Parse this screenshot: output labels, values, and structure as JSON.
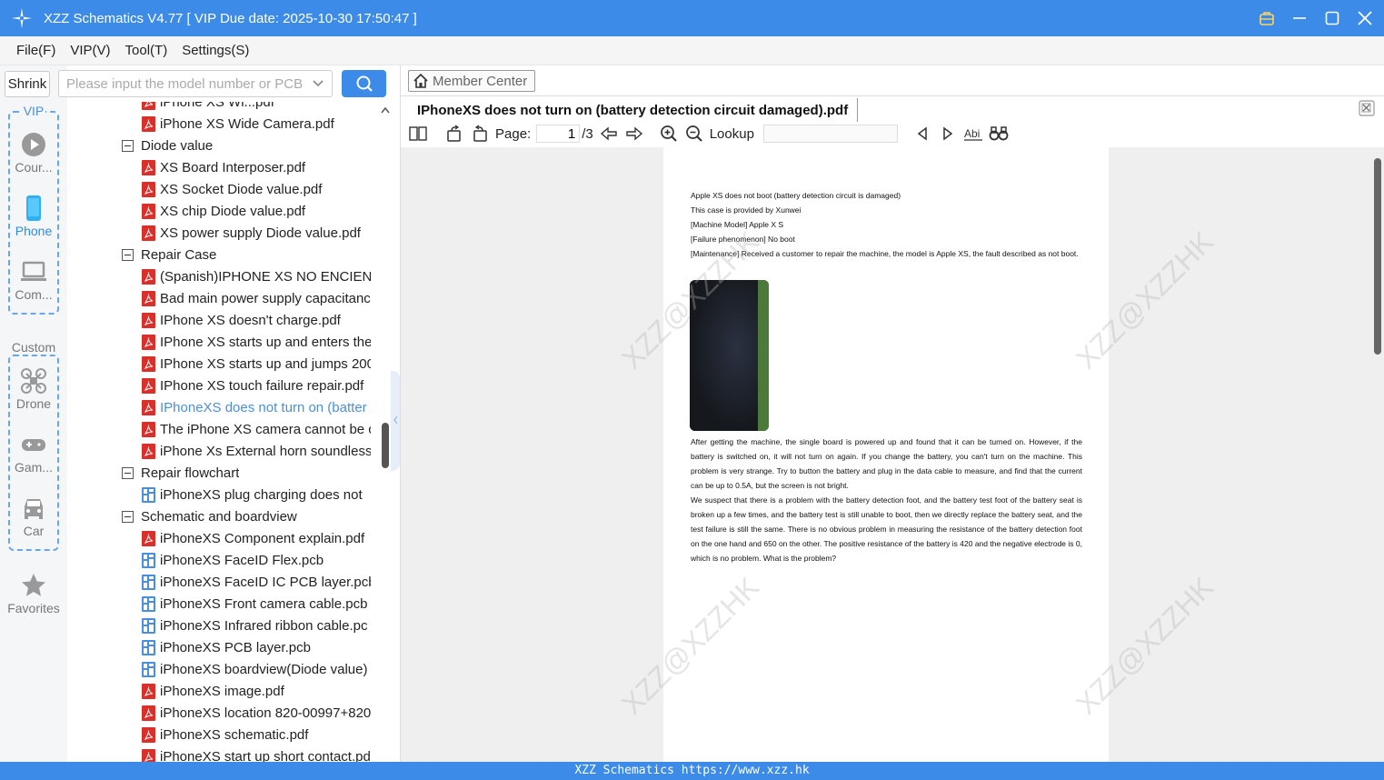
{
  "window": {
    "title": "XZZ Schematics V4.77 [ VIP Due date: 2025-10-30 17:50:47 ]"
  },
  "menu": [
    "File(F)",
    "VIP(V)",
    "Tool(T)",
    "Settings(S)"
  ],
  "left": {
    "shrink_label": "Shrink",
    "vip_label": "VIP",
    "custom_label": "Custom",
    "categories": [
      {
        "label": "Cour...",
        "icon": "play-circle-icon"
      },
      {
        "label": "Phone",
        "icon": "phone-icon"
      },
      {
        "label": "Com...",
        "icon": "laptop-icon"
      },
      {
        "label": "Drone",
        "icon": "drone-icon"
      },
      {
        "label": "Gam...",
        "icon": "gamepad-icon"
      },
      {
        "label": "Car",
        "icon": "car-icon"
      },
      {
        "label": "Favorites",
        "icon": "star-icon"
      }
    ]
  },
  "search": {
    "placeholder": "Please input the model number or PCB"
  },
  "tree": [
    {
      "type": "file",
      "kind": "pdf",
      "label": "iPhone XS Wi...pdf"
    },
    {
      "type": "file",
      "kind": "pdf",
      "label": "iPhone XS Wide Camera.pdf"
    },
    {
      "type": "folder",
      "label": "Diode value"
    },
    {
      "type": "file",
      "kind": "pdf",
      "label": "XS Board Interposer.pdf"
    },
    {
      "type": "file",
      "kind": "pdf",
      "label": "XS Socket Diode value.pdf"
    },
    {
      "type": "file",
      "kind": "pdf",
      "label": "XS chip Diode value.pdf"
    },
    {
      "type": "file",
      "kind": "pdf",
      "label": "XS power supply Diode value.pdf"
    },
    {
      "type": "folder",
      "label": "Repair Case"
    },
    {
      "type": "file",
      "kind": "pdf",
      "label": "(Spanish)IPHONE XS NO ENCIEND"
    },
    {
      "type": "file",
      "kind": "pdf",
      "label": "Bad main power supply capacitanc"
    },
    {
      "type": "file",
      "kind": "pdf",
      "label": "IPhone XS doesn't charge.pdf"
    },
    {
      "type": "file",
      "kind": "pdf",
      "label": "IPhone XS starts up and enters the"
    },
    {
      "type": "file",
      "kind": "pdf",
      "label": "IPhone XS starts up and jumps 200"
    },
    {
      "type": "file",
      "kind": "pdf",
      "label": "IPhone XS touch failure repair.pdf"
    },
    {
      "type": "file",
      "kind": "pdf",
      "label": "IPhoneXS does not turn on (batter",
      "selected": true
    },
    {
      "type": "file",
      "kind": "pdf",
      "label": "The iPhone XS camera cannot be c"
    },
    {
      "type": "file",
      "kind": "pdf",
      "label": "iPhone Xs External horn soundless"
    },
    {
      "type": "folder",
      "label": "Repair flowchart"
    },
    {
      "type": "file",
      "kind": "pcb",
      "label": "iPhoneXS plug charging does not"
    },
    {
      "type": "folder",
      "label": "Schematic and boardview"
    },
    {
      "type": "file",
      "kind": "pdf",
      "label": "iPhoneXS Component explain.pdf"
    },
    {
      "type": "file",
      "kind": "pcb",
      "label": "iPhoneXS FaceID Flex.pcb"
    },
    {
      "type": "file",
      "kind": "pcb",
      "label": "iPhoneXS FaceID IC PCB layer.pcb"
    },
    {
      "type": "file",
      "kind": "pcb",
      "label": "iPhoneXS Front camera cable.pcb"
    },
    {
      "type": "file",
      "kind": "pcb",
      "label": "iPhoneXS Infrared ribbon cable.pc"
    },
    {
      "type": "file",
      "kind": "pcb",
      "label": "iPhoneXS PCB layer.pcb"
    },
    {
      "type": "file",
      "kind": "pcb",
      "label": "iPhoneXS boardview(Diode value)"
    },
    {
      "type": "file",
      "kind": "pdf",
      "label": "iPhoneXS image.pdf"
    },
    {
      "type": "file",
      "kind": "pdf",
      "label": "iPhoneXS location 820-00997+820"
    },
    {
      "type": "file",
      "kind": "pdf",
      "label": "iPhoneXS schematic.pdf"
    },
    {
      "type": "file",
      "kind": "pdf",
      "label": "iPhoneXS start up short contact.pd"
    }
  ],
  "viewer": {
    "member_center": "Member Center",
    "doc_title": "IPhoneXS does not turn on (battery detection circuit damaged).pdf",
    "page_label": "Page:",
    "page_current": "1",
    "page_total": "/3",
    "lookup_label": "Lookup",
    "watermark": "XZZ@XZZHK",
    "doc_lines_top": [
      "Apple XS does not boot (battery detection circuit is damaged)",
      "This case is provided by Xunwei",
      "[Machine Model] Apple X S",
      "[Failure phenomenon] No boot",
      "[Maintenance] Received a customer to repair the machine, the model is Apple XS, the fault described as not boot."
    ],
    "doc_para_1": "After getting the machine, the single board is powered up and found that it can be turned on. However, if the battery is switched on, it will not turn on again. If you change the battery, you can't turn on the machine. This problem is very strange. Try to button the battery and plug in the data cable to measure, and find that the current can be up to 0.5A, but the screen is not bright.",
    "doc_para_2": "We suspect that there is a problem with the battery detection foot, and the battery test foot of the battery seat is broken up a few times, and the battery test is still unable to boot, then we directly replace the battery seat, and the test failure is still the same. There is no obvious problem in measuring the resistance of the battery detection foot on the one hand and 650 on the other. The positive resistance of the battery is 420 and the negative electrode is 0, which is no problem. What is the problem?"
  },
  "status": "XZZ Schematics https://www.xzz.hk",
  "colors": {
    "accent": "#3c8be8",
    "selected_text": "#4a90e2",
    "pdf_icon": "#d9302c",
    "pcb_icon": "#4a8fdd"
  }
}
